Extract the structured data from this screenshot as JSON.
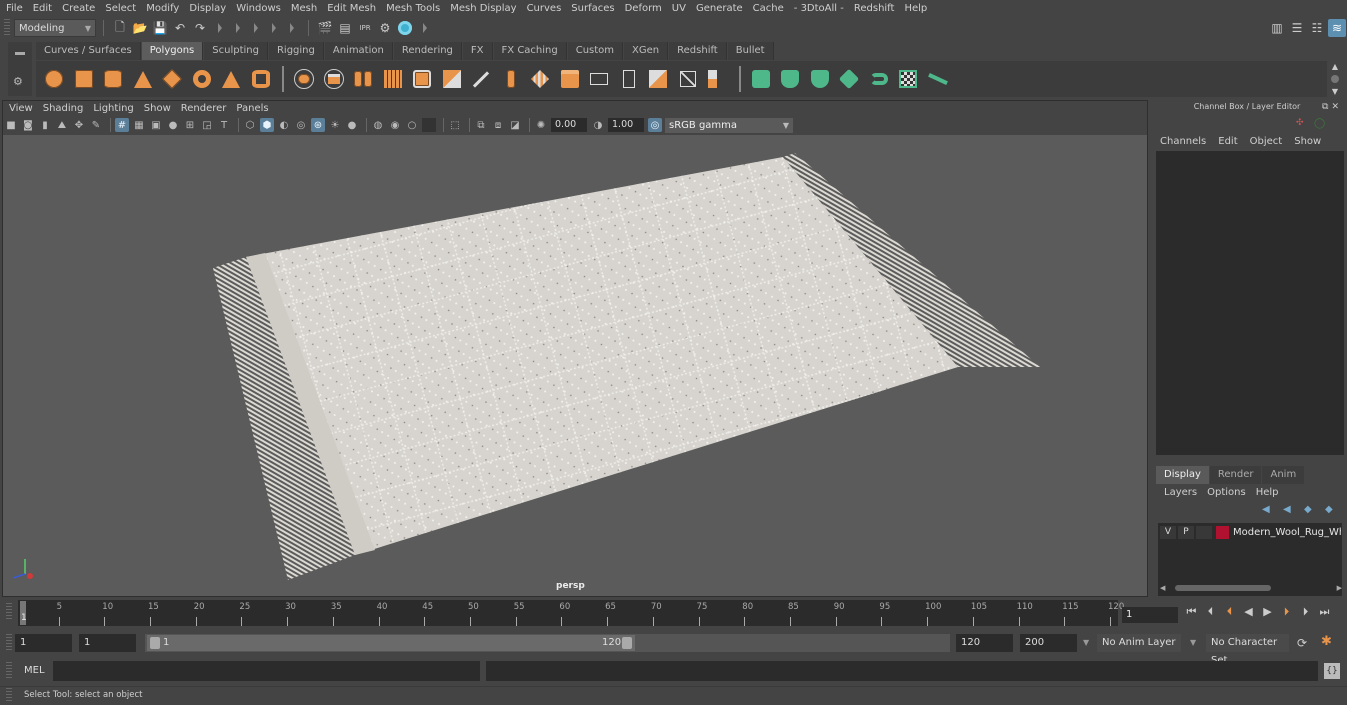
{
  "menubar": {
    "items": [
      "File",
      "Edit",
      "Create",
      "Select",
      "Modify",
      "Display",
      "Windows",
      "Mesh",
      "Edit Mesh",
      "Mesh Tools",
      "Mesh Display",
      "Curves",
      "Surfaces",
      "Deform",
      "UV",
      "Generate",
      "Cache",
      "- 3DtoAll -",
      "Redshift",
      "Help"
    ]
  },
  "statusline": {
    "mode": "Modeling",
    "icons": [
      "new-scene-icon",
      "open-scene-icon",
      "save-scene-icon",
      "undo-icon",
      "redo-icon"
    ],
    "render_icons": [
      "render-view-icon",
      "render-frame-icon",
      "ipr-render-icon",
      "render-settings-icon",
      "hypershade-icon"
    ],
    "right_icons": [
      "modeling-toolkit-icon",
      "attribute-editor-icon",
      "tool-settings-icon",
      "channel-box-icon"
    ]
  },
  "shelf": {
    "tabs": [
      "Curves / Surfaces",
      "Polygons",
      "Sculpting",
      "Rigging",
      "Animation",
      "Rendering",
      "FX",
      "FX Caching",
      "Custom",
      "XGen",
      "Redshift",
      "Bullet"
    ],
    "active_tab": "Polygons",
    "poly_icons": [
      "poly-sphere-icon",
      "poly-cube-icon",
      "poly-cylinder-icon",
      "poly-cone-icon",
      "poly-plane-icon",
      "poly-torus-icon",
      "poly-pyramid-icon",
      "poly-pipe-icon"
    ],
    "tool_icons": [
      "combine-icon",
      "separate-icon",
      "mirror-icon",
      "smooth-icon",
      "bevel-icon",
      "extrude-icon",
      "bridge-icon",
      "multi-cut-icon",
      "target-weld-icon",
      "insert-edge-loop-icon",
      "merge-icon",
      "fill-hole-icon",
      "quad-draw-icon",
      "extract-icon",
      "boolean-icon",
      "collapse-icon"
    ],
    "uv_icons": [
      "planar-map-icon",
      "cylindrical-map-icon",
      "spherical-map-icon",
      "automatic-map-icon",
      "unfold-icon",
      "uv-editor-icon",
      "cut-uv-icon"
    ]
  },
  "viewport": {
    "menu": [
      "View",
      "Shading",
      "Lighting",
      "Show",
      "Renderer",
      "Panels"
    ],
    "exposure": "0.00",
    "gamma": "1.00",
    "color_space": "sRGB gamma",
    "camera_label": "persp"
  },
  "channel_box": {
    "title": "Channel Box / Layer Editor",
    "menu": [
      "Channels",
      "Edit",
      "Object",
      "Show"
    ]
  },
  "layer_editor": {
    "tabs": [
      "Display",
      "Render",
      "Anim"
    ],
    "active_tab": "Display",
    "menu": [
      "Layers",
      "Options",
      "Help"
    ],
    "layers": [
      {
        "visible": "V",
        "playback": "P",
        "color": "#b0112f",
        "name": "Modern_Wool_Rug_White"
      }
    ]
  },
  "timeline": {
    "ticks": [
      5,
      10,
      15,
      20,
      25,
      30,
      35,
      40,
      45,
      50,
      55,
      60,
      65,
      70,
      75,
      80,
      85,
      90,
      95,
      100,
      105,
      110,
      115,
      120
    ],
    "start": 1,
    "end": 120,
    "current_frame": "1"
  },
  "range": {
    "scene_start": "1",
    "playback_start": "1",
    "slider_start": "1",
    "slider_end": "120",
    "playback_end": "120",
    "scene_end": "200",
    "anim_layer": "No Anim Layer",
    "character_set": "No Character Set"
  },
  "command_line": {
    "label": "MEL"
  },
  "help_line": {
    "text": "Select Tool: select an object"
  }
}
